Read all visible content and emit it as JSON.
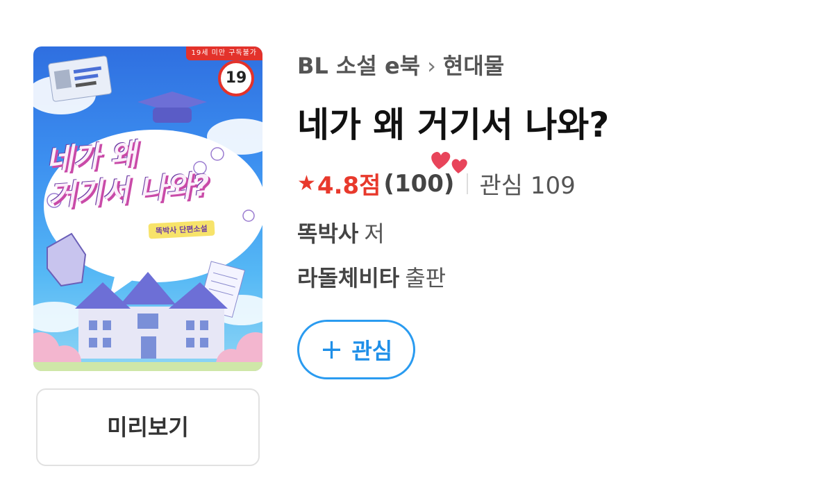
{
  "cover": {
    "age_banner": "19세 미만 구독불가",
    "age_badge": "19",
    "title_line1": "네가 왜",
    "title_line2": "거기서 나와?",
    "subtitle": "똑박사 단편소설"
  },
  "preview_button": "미리보기",
  "breadcrumb": {
    "category": "BL 소설 e북",
    "separator": "›",
    "subcategory": "현대물"
  },
  "title": "네가 왜 거기서 나와?",
  "rating": {
    "star": "★",
    "score": "4.8점",
    "count": "(100)",
    "interest": "관심 109"
  },
  "author": {
    "name": "똑박사",
    "role": "저"
  },
  "publisher": {
    "name": "라돌체비타",
    "role": "출판"
  },
  "follow_button": {
    "icon": "plus-icon",
    "label": "관심"
  },
  "colors": {
    "accent_red": "#e8392c",
    "accent_blue": "#2a9bf0",
    "heart": "#e8445a"
  }
}
